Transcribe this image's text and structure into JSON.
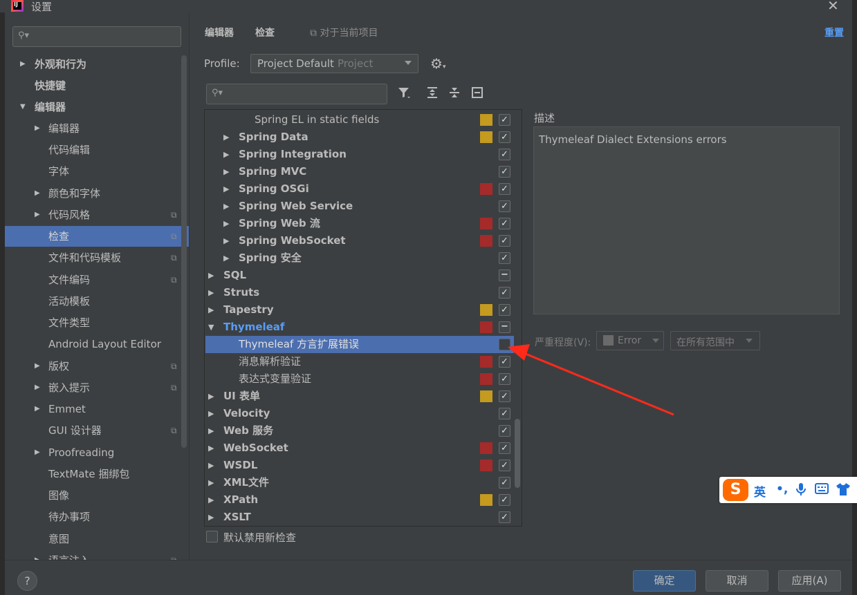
{
  "window": {
    "title": "设置",
    "app_icon_letter": "IJ"
  },
  "sidebar": {
    "search_placeholder": "",
    "items": [
      {
        "label": "外观和行为",
        "bold": true,
        "arrow": "▶"
      },
      {
        "label": "快捷键",
        "bold": true
      },
      {
        "label": "编辑器",
        "bold": true,
        "arrow": "▼"
      },
      {
        "label": "编辑器",
        "arrow": "▶"
      },
      {
        "label": "代码编辑"
      },
      {
        "label": "字体"
      },
      {
        "label": "颜色和字体",
        "arrow": "▶"
      },
      {
        "label": "代码风格",
        "arrow": "▶",
        "copy": true
      },
      {
        "label": "检查",
        "selected": true,
        "copy": true
      },
      {
        "label": "文件和代码模板",
        "copy": true
      },
      {
        "label": "文件编码",
        "copy": true
      },
      {
        "label": "活动模板"
      },
      {
        "label": "文件类型"
      },
      {
        "label": "Android Layout Editor"
      },
      {
        "label": "版权",
        "arrow": "▶",
        "copy": true
      },
      {
        "label": "嵌入提示",
        "arrow": "▶",
        "copy": true
      },
      {
        "label": "Emmet",
        "arrow": "▶"
      },
      {
        "label": "GUI 设计器",
        "copy": true
      },
      {
        "label": "Proofreading",
        "arrow": "▶"
      },
      {
        "label": "TextMate 捆绑包"
      },
      {
        "label": "图像"
      },
      {
        "label": "待办事项"
      },
      {
        "label": "意图"
      },
      {
        "label": "语言注入",
        "arrow": "▶",
        "copy": true
      }
    ]
  },
  "header": {
    "breadcrumb": [
      "编辑器",
      "检查"
    ],
    "breadcrumb_separator": "›",
    "scope_note": "对于当前项目",
    "reset_label": "重置"
  },
  "profile": {
    "label": "Profile:",
    "value": "Project Default",
    "scope": "Project"
  },
  "toolbar": {
    "filter_icon": "filter-icon",
    "expand_icon": "expand-all-icon",
    "collapse_icon": "collapse-all-icon",
    "reset_icon": "restore-icon"
  },
  "tree": {
    "rows": [
      {
        "label": "Spring EL in static fields",
        "level": 2,
        "sev": "#c49a1f",
        "check": "✓"
      },
      {
        "label": "Spring Data",
        "level": 1,
        "bold": true,
        "arrow": "▶",
        "sev": "#c49a1f",
        "check": "✓"
      },
      {
        "label": "Spring Integration",
        "level": 1,
        "bold": true,
        "arrow": "▶",
        "sev": "",
        "check": "✓"
      },
      {
        "label": "Spring MVC",
        "level": 1,
        "bold": true,
        "arrow": "▶",
        "sev": "",
        "check": "✓"
      },
      {
        "label": "Spring OSGi",
        "level": 1,
        "bold": true,
        "arrow": "▶",
        "sev": "#a52a2a",
        "check": "✓"
      },
      {
        "label": "Spring Web Service",
        "level": 1,
        "bold": true,
        "arrow": "▶",
        "sev": "",
        "check": "✓"
      },
      {
        "label": "Spring Web 流",
        "level": 1,
        "bold": true,
        "arrow": "▶",
        "sev": "#a52a2a",
        "check": "✓"
      },
      {
        "label": "Spring WebSocket",
        "level": 1,
        "bold": true,
        "arrow": "▶",
        "sev": "#a52a2a",
        "check": "✓"
      },
      {
        "label": "Spring 安全",
        "level": 1,
        "bold": true,
        "arrow": "▶",
        "sev": "",
        "check": "✓"
      },
      {
        "label": "SQL",
        "level": 0,
        "bold": true,
        "arrow": "▶",
        "sev": "",
        "check": "−"
      },
      {
        "label": "Struts",
        "level": 0,
        "bold": true,
        "arrow": "▶",
        "sev": "",
        "check": "✓"
      },
      {
        "label": "Tapestry",
        "level": 0,
        "bold": true,
        "arrow": "▶",
        "sev": "#c49a1f",
        "check": "✓"
      },
      {
        "label": "Thymeleaf",
        "level": 0,
        "bold": true,
        "arrow": "▼",
        "blue": true,
        "sev": "#a52a2a",
        "check": "−"
      },
      {
        "label": "Thymeleaf 方言扩展错误",
        "level": 1,
        "selected": true,
        "sev": "",
        "check": ""
      },
      {
        "label": "消息解析验证",
        "level": 1,
        "sev": "#a52a2a",
        "check": "✓"
      },
      {
        "label": "表达式变量验证",
        "level": 1,
        "sev": "#a52a2a",
        "check": "✓"
      },
      {
        "label": "UI 表单",
        "level": 0,
        "bold": true,
        "arrow": "▶",
        "sev": "#c49a1f",
        "check": "✓"
      },
      {
        "label": "Velocity",
        "level": 0,
        "bold": true,
        "arrow": "▶",
        "sev": "",
        "check": "✓"
      },
      {
        "label": "Web 服务",
        "level": 0,
        "bold": true,
        "arrow": "▶",
        "sev": "",
        "check": "✓"
      },
      {
        "label": "WebSocket",
        "level": 0,
        "bold": true,
        "arrow": "▶",
        "sev": "#a52a2a",
        "check": "✓"
      },
      {
        "label": "WSDL",
        "level": 0,
        "bold": true,
        "arrow": "▶",
        "sev": "#a52a2a",
        "check": "✓"
      },
      {
        "label": "XML文件",
        "level": 0,
        "bold": true,
        "arrow": "▶",
        "sev": "",
        "check": "✓"
      },
      {
        "label": "XPath",
        "level": 0,
        "bold": true,
        "arrow": "▶",
        "sev": "#c49a1f",
        "check": "✓"
      },
      {
        "label": "XSLT",
        "level": 0,
        "bold": true,
        "arrow": "▶",
        "sev": "",
        "check": "✓"
      }
    ]
  },
  "description": {
    "title": "描述",
    "text": "Thymeleaf Dialect Extensions errors",
    "severity_label": "严重程度(V):",
    "severity_value": "Error",
    "scope_value": "在所有范围中"
  },
  "options": {
    "disable_new_label": "默认禁用新检查"
  },
  "footer": {
    "help": "?",
    "ok": "确定",
    "cancel": "取消",
    "apply": "应用(A)"
  },
  "ime": {
    "logo": "S",
    "lang": "英",
    "punct": "•,",
    "mic_icon": "microphone-icon",
    "keyboard_icon": "keyboard-icon",
    "skin_icon": "shirt-icon"
  }
}
